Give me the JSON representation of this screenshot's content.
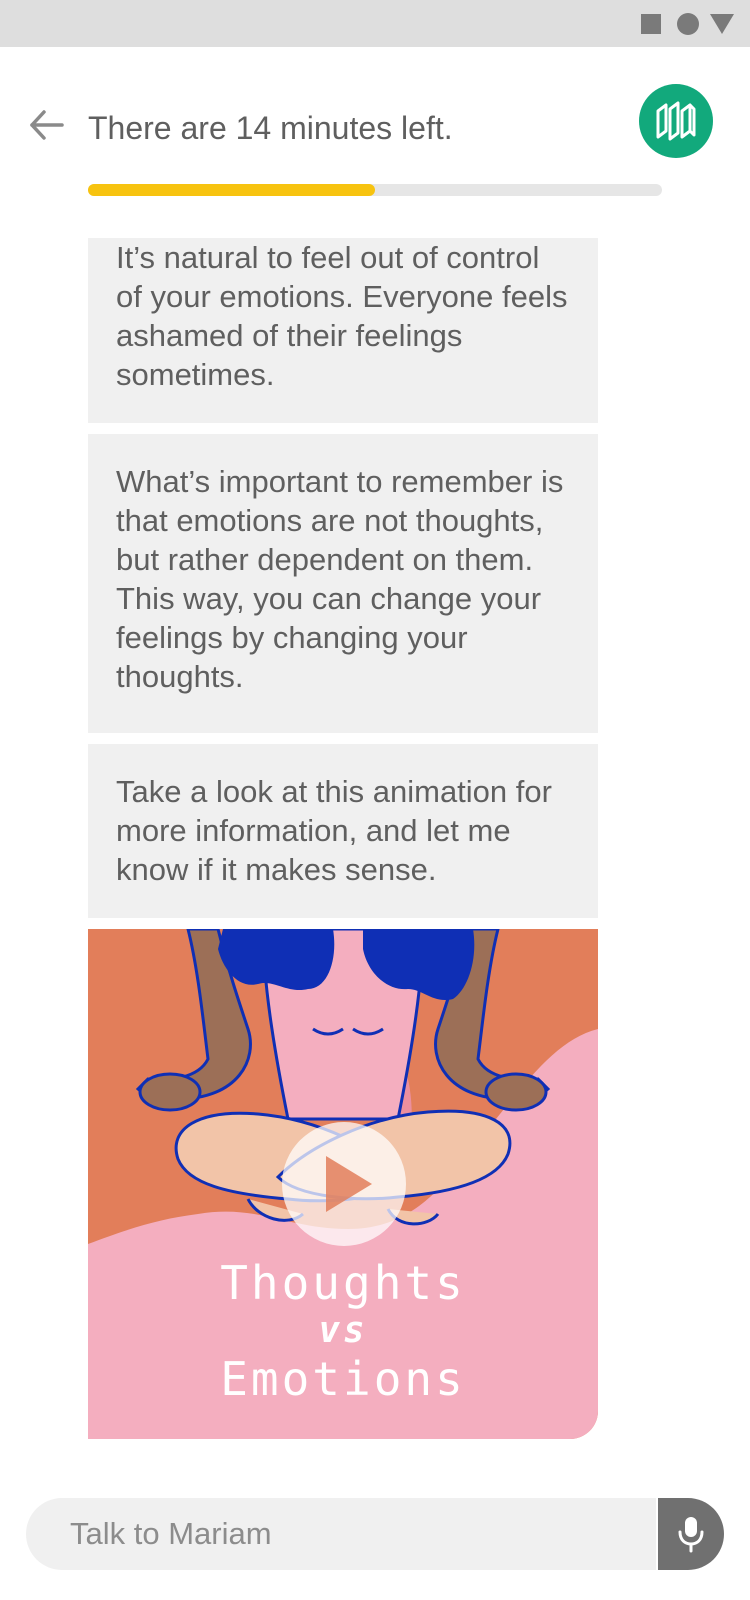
{
  "status_bar": {
    "icons": [
      "square-icon",
      "circle-icon",
      "triangle-down-icon"
    ],
    "color": "#7a7a7a"
  },
  "header": {
    "back_icon": "arrow-left-icon",
    "title": "There are 14 minutes left.",
    "avatar_icon": "brand-logo-icon",
    "avatar_color": "#12a97c",
    "progress": 0.5
  },
  "messages": [
    {
      "text": "It’s natural to feel out of control of your emotions. Everyone feels ashamed of their feelings sometimes."
    },
    {
      "text": "What’s important to remember is that emotions are not thoughts, but rather dependent on them. This way, you can change your feelings by changing your thoughts."
    },
    {
      "text": "Take a look at this animation for more information, and let me know if it makes sense."
    }
  ],
  "video": {
    "title_line1": "Thoughts",
    "title_line2": "vs",
    "title_line3": "Emotions",
    "play_icon": "play-icon"
  },
  "composer": {
    "placeholder": "Talk to Mariam",
    "mic_icon": "microphone-icon"
  },
  "colors": {
    "accent": "#f7c30f",
    "bubble_bg": "#f0f0f0",
    "text": "#5f5f5f",
    "video_orange": "#e27e5a",
    "video_pink": "#f4aebf",
    "video_blue": "#0f2fb5"
  }
}
